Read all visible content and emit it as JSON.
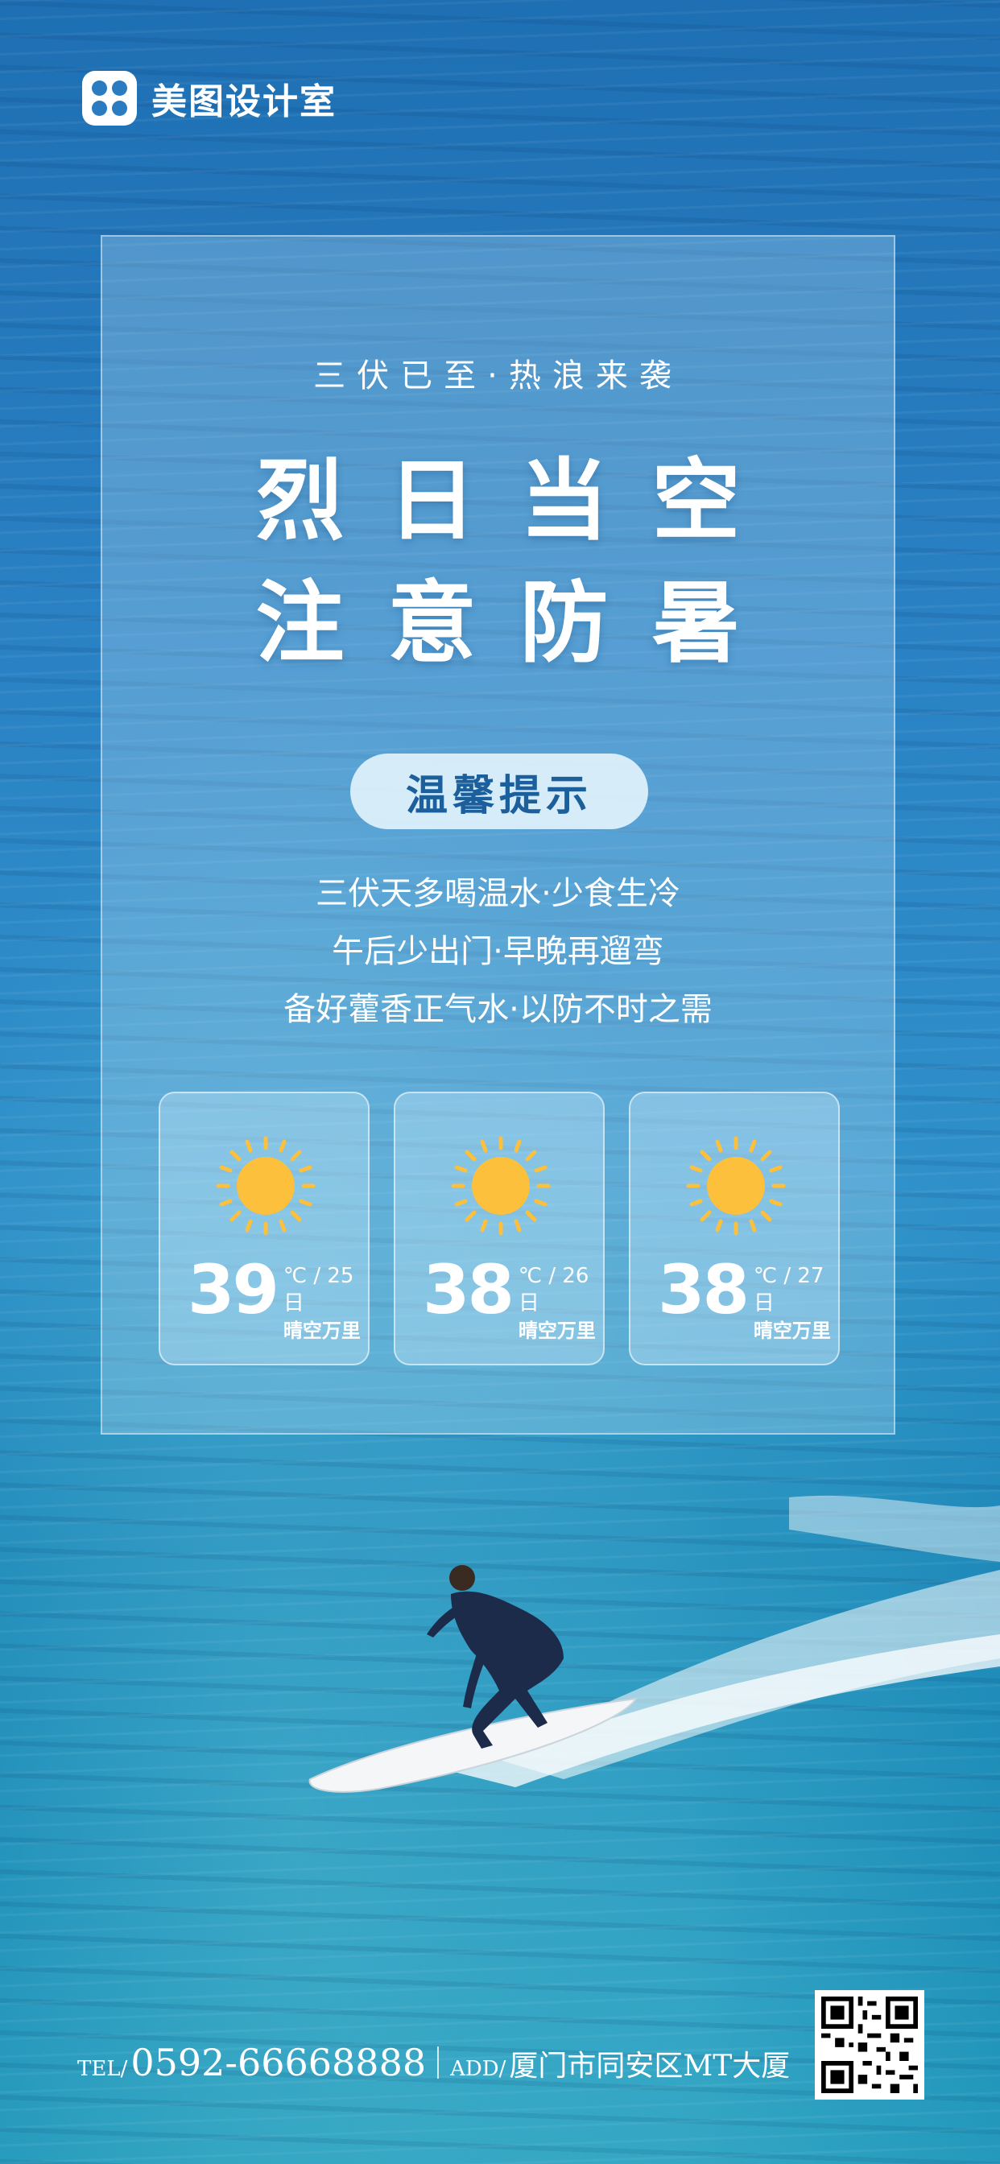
{
  "brand": {
    "name": "美图设计室",
    "logo_icon": "meitu-logo-icon"
  },
  "poster": {
    "subtitle": "三伏已至·热浪来袭",
    "headline_1": "烈日当空",
    "headline_2": "注意防暑",
    "tip_badge": "温馨提示",
    "tips": [
      "三伏天多喝温水·少食生冷",
      "午后少出门·早晚再遛弯",
      "备好藿香正气水·以防不时之需"
    ]
  },
  "forecast": [
    {
      "temp": "39",
      "date": "℃ / 25日",
      "desc": "晴空万里",
      "icon": "sun-icon"
    },
    {
      "temp": "38",
      "date": "℃ / 26日",
      "desc": "晴空万里",
      "icon": "sun-icon"
    },
    {
      "temp": "38",
      "date": "℃ / 27日",
      "desc": "晴空万里",
      "icon": "sun-icon"
    }
  ],
  "contact": {
    "tel_label": "TEL/",
    "tel": "0592-66668888",
    "addr_label": "ADD/",
    "address": "厦门市同安区MT大厦"
  },
  "colors": {
    "accent": "#1b5f9c",
    "sun": "#fcc03c",
    "ocean": "#2a82c4"
  }
}
